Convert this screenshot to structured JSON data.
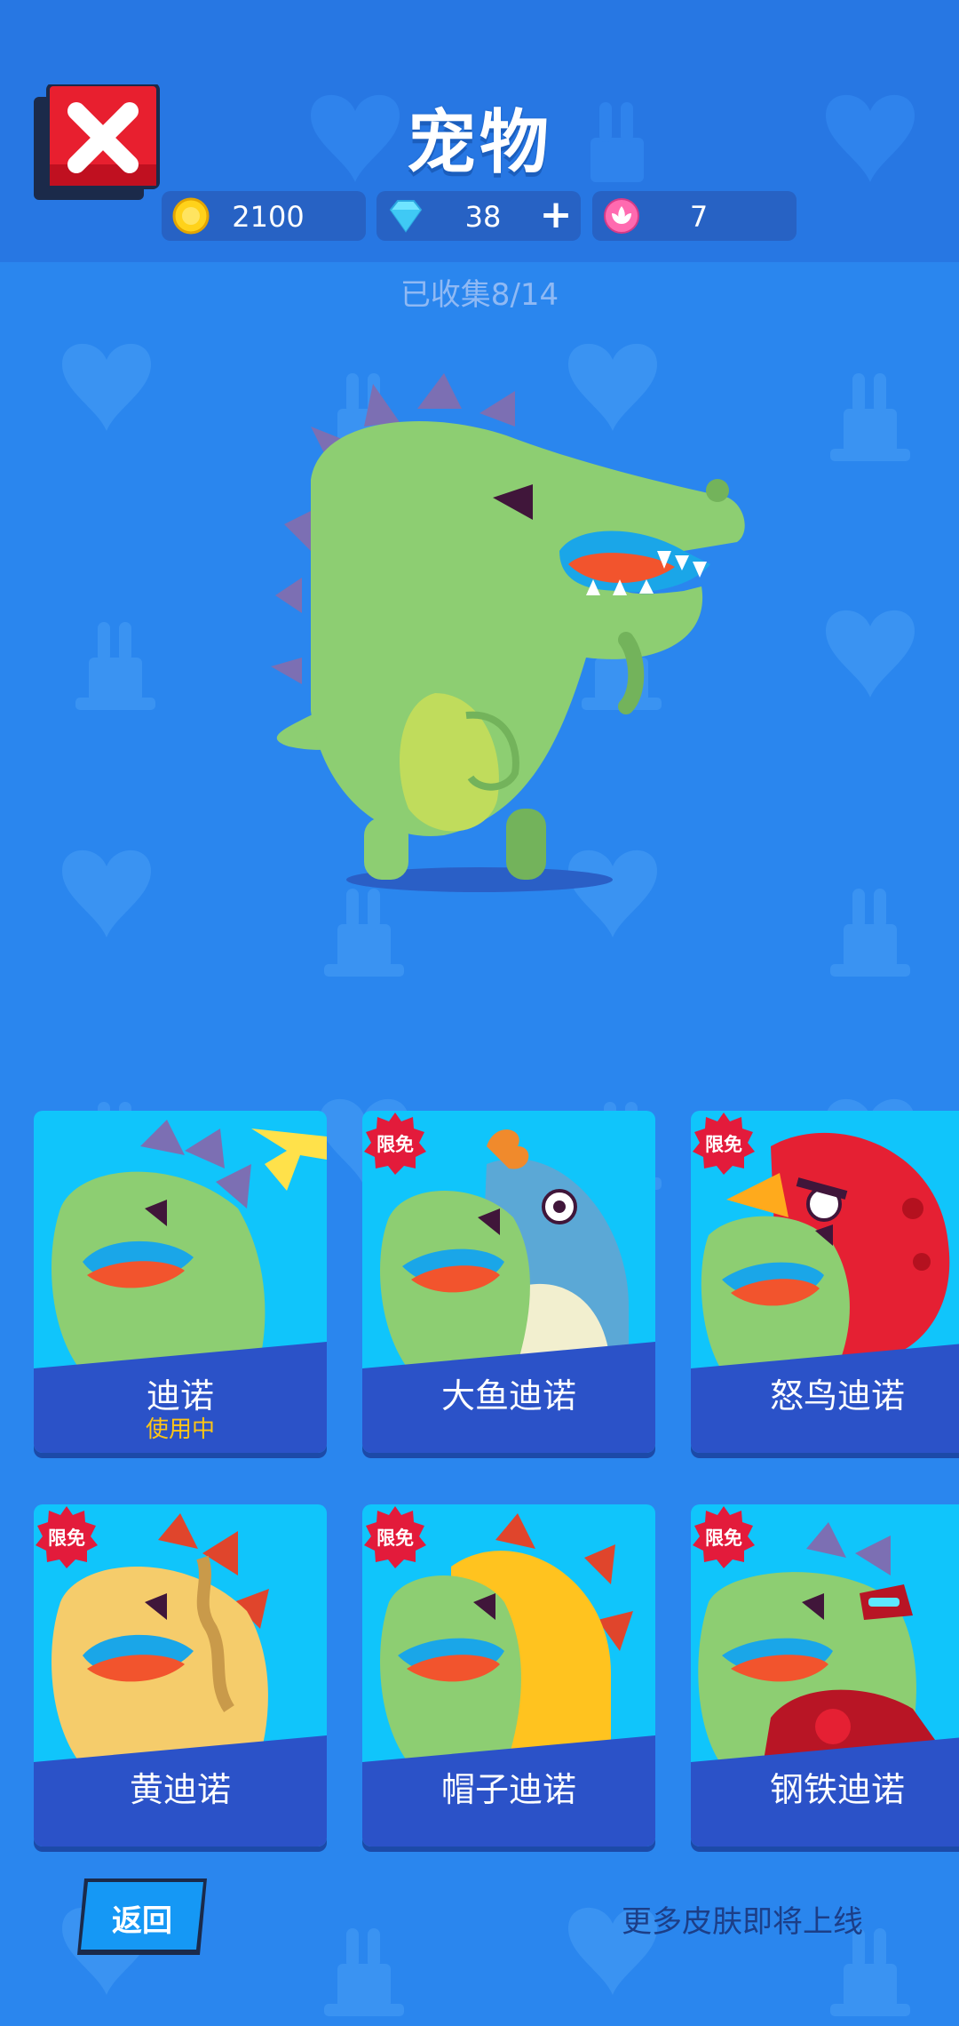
{
  "header": {
    "title": "宠物",
    "close_icon": "close-x-icon"
  },
  "currencies": [
    {
      "icon": "gold-coin-icon",
      "value": "2100"
    },
    {
      "icon": "diamond-icon",
      "value": "38",
      "plus": "+"
    },
    {
      "icon": "lotus-token-icon",
      "value": "7"
    }
  ],
  "collection": {
    "text": "已收集8/14"
  },
  "colors": {
    "background": "#2a86ee",
    "header": "#2777e3",
    "card_top": "#10c5fb",
    "card_band": "#2b52c8",
    "in_use": "#ffc514",
    "badge": "#e31b3b"
  },
  "pets": [
    {
      "name": "迪诺",
      "status": "使用中",
      "badge": ""
    },
    {
      "name": "大鱼迪诺",
      "status": "",
      "badge": "限免"
    },
    {
      "name": "怒鸟迪诺",
      "status": "",
      "badge": "限免"
    },
    {
      "name": "黄迪诺",
      "status": "",
      "badge": "限免"
    },
    {
      "name": "帽子迪诺",
      "status": "",
      "badge": "限免"
    },
    {
      "name": "钢铁迪诺",
      "status": "",
      "badge": "限免"
    }
  ],
  "footer": {
    "back_label": "返回",
    "more_text": "更多皮肤即将上线"
  }
}
